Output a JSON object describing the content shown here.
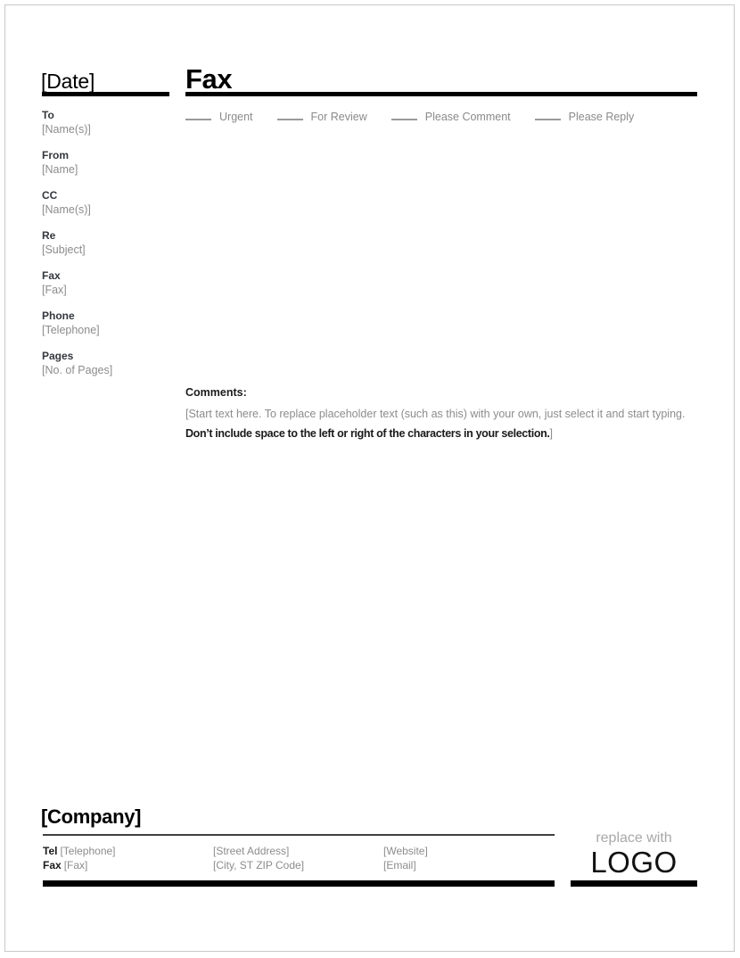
{
  "document": {
    "type": "fax-cover-sheet",
    "date_heading": "[Date]",
    "title": "Fax"
  },
  "fields": [
    {
      "label": "To",
      "value": "[Name(s)]"
    },
    {
      "label": "From",
      "value": "[Name]"
    },
    {
      "label": "CC",
      "value": "[Name(s)]"
    },
    {
      "label": "Re",
      "value": "[Subject]"
    },
    {
      "label": "Fax",
      "value": "[Fax]"
    },
    {
      "label": "Phone",
      "value": "[Telephone]"
    },
    {
      "label": "Pages",
      "value": "[No. of Pages]"
    }
  ],
  "options": [
    {
      "label": "Urgent"
    },
    {
      "label": "For Review"
    },
    {
      "label": "Please Comment"
    },
    {
      "label": "Please Reply"
    }
  ],
  "comments": {
    "heading": "Comments:",
    "placeholder_start": "[Start text here. To replace placeholder text (such as this) with your own, just select it and start typing. ",
    "emphasis": "Don’t include space to the left or right of the characters in your selection.",
    "placeholder_end": "]"
  },
  "footer": {
    "company": "[Company]",
    "contacts": {
      "col1": [
        {
          "key": "Tel",
          "value": "[Telephone]"
        },
        {
          "key": "Fax",
          "value": "[Fax]"
        }
      ],
      "col2": [
        {
          "value": "[Street Address]"
        },
        {
          "value": "[City, ST  ZIP Code]"
        }
      ],
      "col3": [
        {
          "value": "[Website]"
        },
        {
          "value": "[Email]"
        }
      ]
    },
    "logo": {
      "sub": "replace with",
      "main": "LOGO"
    }
  },
  "colors": {
    "rule": "#000000",
    "placeholder": "#8c8c8c",
    "label": "#33383d",
    "page_border": "#c8c8c8"
  }
}
